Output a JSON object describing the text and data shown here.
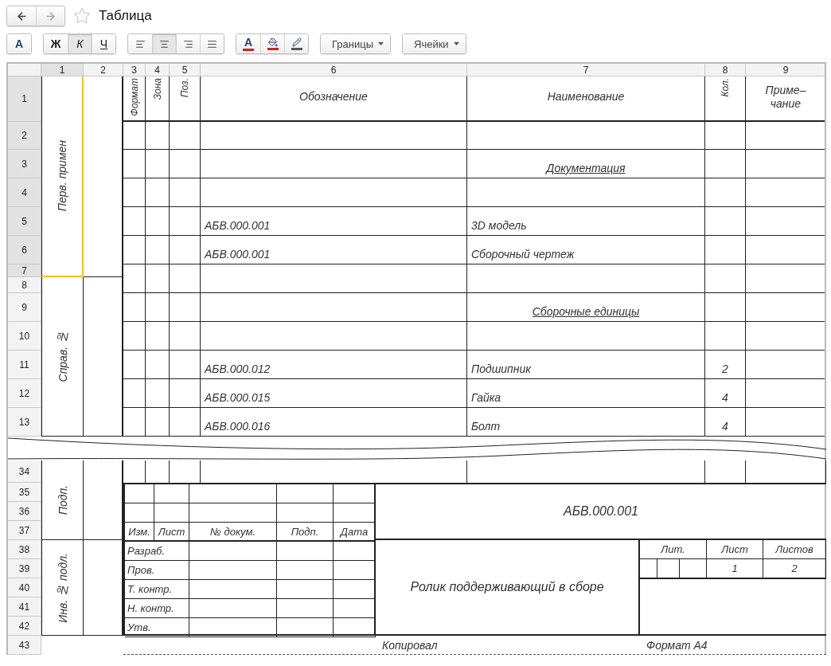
{
  "header": {
    "title": "Таблица",
    "favorite": false
  },
  "nav": [
    {
      "kind": "back",
      "disabled": false
    },
    {
      "kind": "forward",
      "disabled": true
    }
  ],
  "toolbar": {
    "groups": [
      [
        {
          "kind": "font",
          "label": "A",
          "selected": false
        }
      ],
      [
        {
          "kind": "bold",
          "label": "Ж",
          "selected": false
        },
        {
          "kind": "italic",
          "label": "К",
          "selected": true
        },
        {
          "kind": "underline",
          "label": "Ч",
          "selected": false
        }
      ],
      [
        {
          "kind": "align-left",
          "selected": false
        },
        {
          "kind": "align-center",
          "selected": true
        },
        {
          "kind": "align-right",
          "selected": false
        },
        {
          "kind": "justify",
          "selected": false
        }
      ],
      [
        {
          "kind": "text-color",
          "label": "A",
          "selected": false
        },
        {
          "kind": "fill-color",
          "selected": false
        },
        {
          "kind": "pen",
          "selected": false
        }
      ],
      [
        {
          "kind": "dropdown",
          "label": "Границы",
          "selected": false
        }
      ],
      [
        {
          "kind": "dropdown",
          "label": "Ячейки",
          "selected": false
        }
      ]
    ]
  },
  "sheet": {
    "columns": [
      {
        "label": "1",
        "selected": true
      },
      {
        "label": "2",
        "selected": false
      },
      {
        "label": "3",
        "selected": false
      },
      {
        "label": "4",
        "selected": false
      },
      {
        "label": "5",
        "selected": false
      },
      {
        "label": "6",
        "selected": false
      },
      {
        "label": "7",
        "selected": false
      },
      {
        "label": "8",
        "selected": false
      },
      {
        "label": "9",
        "selected": false
      }
    ],
    "upper": {
      "row_headers": [
        {
          "label": "1",
          "selected": true
        },
        {
          "label": "2",
          "selected": true
        },
        {
          "label": "3",
          "selected": true
        },
        {
          "label": "4",
          "selected": true
        },
        {
          "label": "5",
          "selected": true
        },
        {
          "label": "6",
          "selected": true
        },
        {
          "label": "7",
          "selected": true
        },
        {
          "label": "8",
          "selected": false
        },
        {
          "label": "9",
          "selected": false
        },
        {
          "label": "10",
          "selected": false
        },
        {
          "label": "11",
          "selected": false
        },
        {
          "label": "12",
          "selected": false
        },
        {
          "label": "13",
          "selected": false
        }
      ],
      "side_blocks": [
        {
          "label": "Перв. примен",
          "selected": true
        },
        {
          "label": "Справ. №",
          "selected": false
        }
      ],
      "spec_header": {
        "format": "Формат",
        "zone": "Зона",
        "position": "Поз.",
        "designation": "Обозначение",
        "name": "Наименование",
        "quantity": "Кол.",
        "note": "Приме–\nчание"
      },
      "spec_rows": [
        {
          "kind": "empty"
        },
        {
          "kind": "section",
          "title": "Документация"
        },
        {
          "kind": "empty"
        },
        {
          "kind": "item",
          "designation": "АБВ.000.001",
          "name": "3D модель"
        },
        {
          "kind": "item",
          "designation": "АБВ.000.001",
          "name": "Сборочный чертеж"
        },
        {
          "kind": "empty"
        },
        {
          "kind": "section",
          "title": "Сборочные единицы"
        },
        {
          "kind": "empty"
        },
        {
          "kind": "item",
          "designation": "АБВ.000.012",
          "name": "Подшипник",
          "quantity": "2"
        },
        {
          "kind": "item",
          "designation": "АБВ.000.015",
          "name": "Гайка",
          "quantity": "4"
        },
        {
          "kind": "item",
          "designation": "АБВ.000.016",
          "name": "Болт",
          "quantity": "4"
        }
      ]
    },
    "lower": {
      "row_headers": [
        {
          "label": "34",
          "selected": false
        },
        {
          "label": "35",
          "selected": false
        },
        {
          "label": "36",
          "selected": false
        },
        {
          "label": "37",
          "selected": false
        },
        {
          "label": "38",
          "selected": false
        },
        {
          "label": "39",
          "selected": false
        },
        {
          "label": "40",
          "selected": false
        },
        {
          "label": "41",
          "selected": false
        },
        {
          "label": "42",
          "selected": false
        },
        {
          "label": "43",
          "selected": false
        }
      ],
      "side_blocks": [
        {
          "label": "Подп.",
          "selected": false
        },
        {
          "label": "Инв. № подл.",
          "selected": false
        }
      ],
      "title_block": {
        "change_columns": [
          "Изм.",
          "Лист",
          "№ докум.",
          "Подп.",
          "Дата"
        ],
        "roles": [
          "Разраб.",
          "Пров.",
          "Т. контр.",
          "Н. контр.",
          "Утв."
        ],
        "designation": "АБВ.000.001",
        "name": "Ролик поддерживающий в сборе",
        "sheet_columns": [
          "Лит.",
          "Лист",
          "Листов"
        ],
        "sheet": "1",
        "sheets": "2"
      },
      "footer": {
        "copied": "Копировал",
        "format": "Формат А4"
      }
    }
  }
}
